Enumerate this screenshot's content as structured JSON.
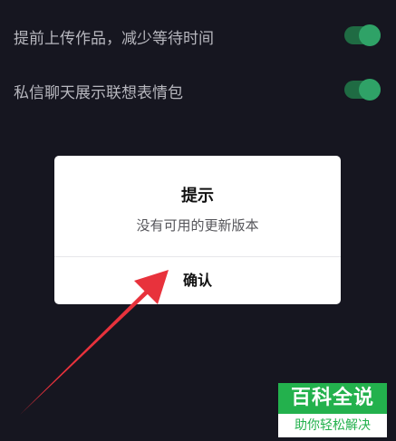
{
  "settings": [
    {
      "label": "提前上传作品，减少等待时间",
      "enabled": true
    },
    {
      "label": "私信聊天展示联想表情包",
      "enabled": true
    }
  ],
  "dialog": {
    "title": "提示",
    "message": "没有可用的更新版本",
    "confirm_label": "确认"
  },
  "watermark": {
    "title": "百科全说",
    "subtitle": "助你轻松解决"
  },
  "colors": {
    "background": "#161620",
    "toggle_on": "#2fa267",
    "arrow": "#e8323c",
    "watermark_green": "#23b14d"
  }
}
